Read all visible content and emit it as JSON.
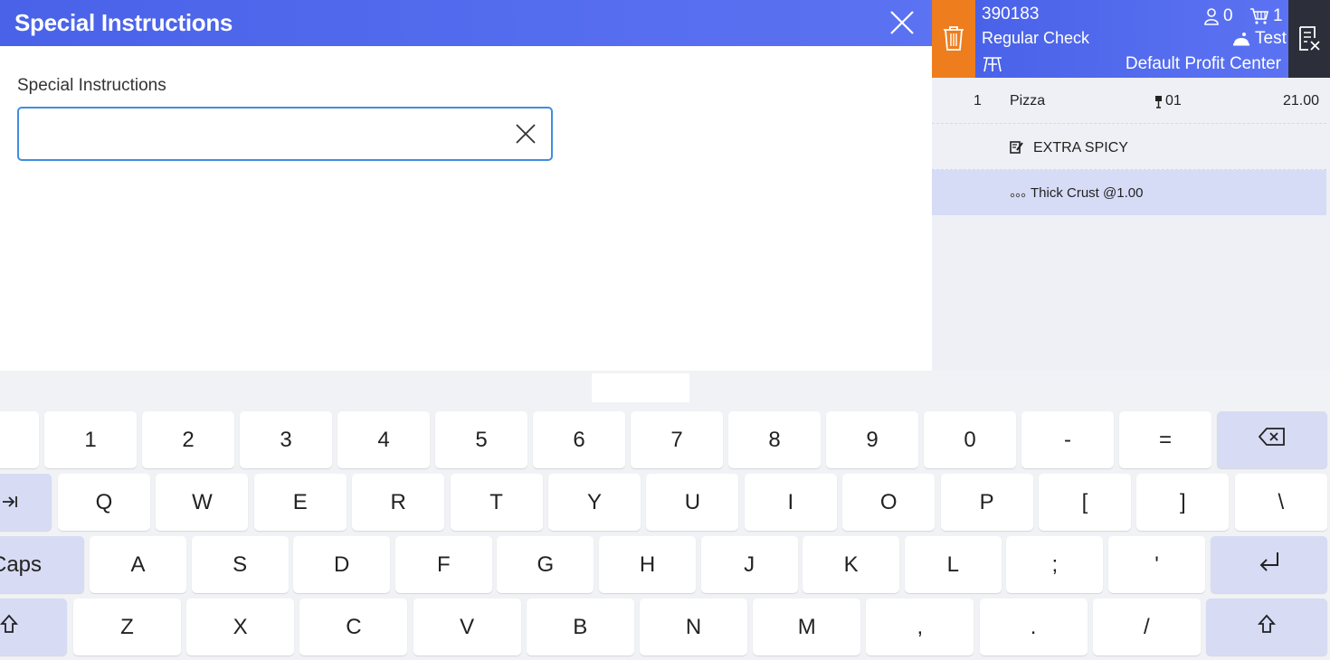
{
  "dialog": {
    "title": "Special Instructions",
    "field_label": "Special Instructions",
    "field_value": "",
    "icons": {
      "close": "close-icon",
      "clear": "clear-icon"
    }
  },
  "check": {
    "number": "390183",
    "type": "Regular Check",
    "guests": "0",
    "items_count": "1",
    "server": "Test",
    "profit_center": "Default Profit Center",
    "icons": {
      "trash": "trash-icon",
      "guest": "guest-icon",
      "cart": "cart-icon",
      "server": "server-icon",
      "table": "table-icon",
      "close_check": "close-check-icon"
    },
    "accent_color": "#ee7d1e",
    "header_color": "#4a62e8",
    "lines": [
      {
        "qty": "1",
        "name": "Pizza",
        "seat": "01",
        "price": "21.00"
      },
      {
        "modifier": "EXTRA SPICY"
      },
      {
        "option": "Thick Crust @1.00"
      }
    ]
  },
  "keyboard": {
    "row1": [
      "1",
      "2",
      "3",
      "4",
      "5",
      "6",
      "7",
      "8",
      "9",
      "0",
      "-",
      "="
    ],
    "row2": [
      "Q",
      "W",
      "E",
      "R",
      "T",
      "Y",
      "U",
      "I",
      "O",
      "P",
      "[",
      "]",
      "\\"
    ],
    "row3": [
      "A",
      "S",
      "D",
      "F",
      "G",
      "H",
      "J",
      "K",
      "L",
      ";",
      "'"
    ],
    "row4": [
      "Z",
      "X",
      "C",
      "V",
      "B",
      "N",
      "M",
      ",",
      ".",
      "/"
    ],
    "caps_label": "Caps",
    "icons": {
      "backspace": "backspace-icon",
      "tab": "tab-icon",
      "enter": "enter-icon",
      "shift": "shift-icon"
    }
  }
}
